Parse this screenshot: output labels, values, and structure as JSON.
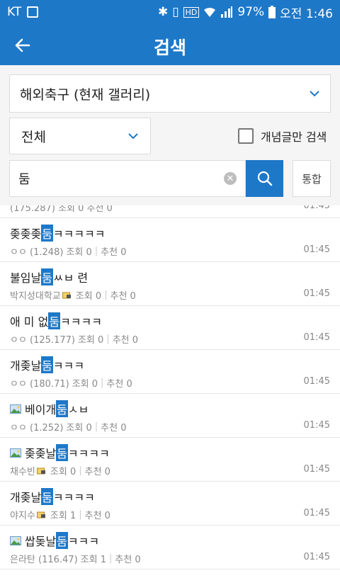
{
  "status": {
    "carrier": "KT",
    "battery": "97%",
    "time": "오전 1:46"
  },
  "header": {
    "title": "검색"
  },
  "controls": {
    "gallery": "해외축구 (현재 갤러리)",
    "scope": "전체",
    "concept_label": "개념글만 검색",
    "query": "둠",
    "total_button": "통합"
  },
  "colors": {
    "accent": "#1e78c8"
  },
  "partial_row": {
    "meta": "(175.287) 조회 0 추천 0",
    "time": "01:45"
  },
  "results": [
    {
      "pre": "좆좆좆",
      "hl": "둠",
      "post": "ㅋㅋㅋㅋㅋ",
      "author": "ㅇㅇ (1.248)",
      "views": "조회 0",
      "votes": "추천 0",
      "time": "01:45",
      "image": false,
      "lock": false
    },
    {
      "pre": "불임날",
      "hl": "둠",
      "post": " ㅆㅂ 련",
      "author": "박지성대학교",
      "views": "조회 0",
      "votes": "추천 0",
      "time": "01:45",
      "image": false,
      "lock": true
    },
    {
      "pre": "애 미 없 ",
      "hl": "둠",
      "post": " ㅋㅋㅋㅋ",
      "author": "ㅇㅇ (125.177)",
      "views": "조회 0",
      "votes": "추천 0",
      "time": "01:45",
      "image": false,
      "lock": false
    },
    {
      "pre": "개좆날",
      "hl": "둠",
      "post": "ㅋㅋㅋ",
      "author": "ㅇㅇ (180.71)",
      "views": "조회 0",
      "votes": "추천 0",
      "time": "01:45",
      "image": false,
      "lock": false
    },
    {
      "pre": "베이개",
      "hl": "둠",
      "post": "ㅅㅂ",
      "author": "ㅇㅇ (1.252)",
      "views": "조회 0",
      "votes": "추천 0",
      "time": "01:45",
      "image": true,
      "lock": false
    },
    {
      "pre": "좆좆날",
      "hl": "둠",
      "post": "ㅋㅋㅋㅋ",
      "author": "채수빈",
      "views": "조회 0",
      "votes": "추천 0",
      "time": "01:45",
      "image": true,
      "lock": true
    },
    {
      "pre": "개좆날",
      "hl": "둠",
      "post": "ㅋㅋㅋㅋ",
      "author": "야지수",
      "views": "조회 1",
      "votes": "추천 0",
      "time": "01:45",
      "image": false,
      "lock": true
    },
    {
      "pre": "쌉돚날",
      "hl": "둠",
      "post": "ㅋㅋㅋ",
      "author": "은라탄 (116.47)",
      "views": "조회 1",
      "votes": "추천 0",
      "time": "01:45",
      "image": true,
      "lock": false
    }
  ]
}
